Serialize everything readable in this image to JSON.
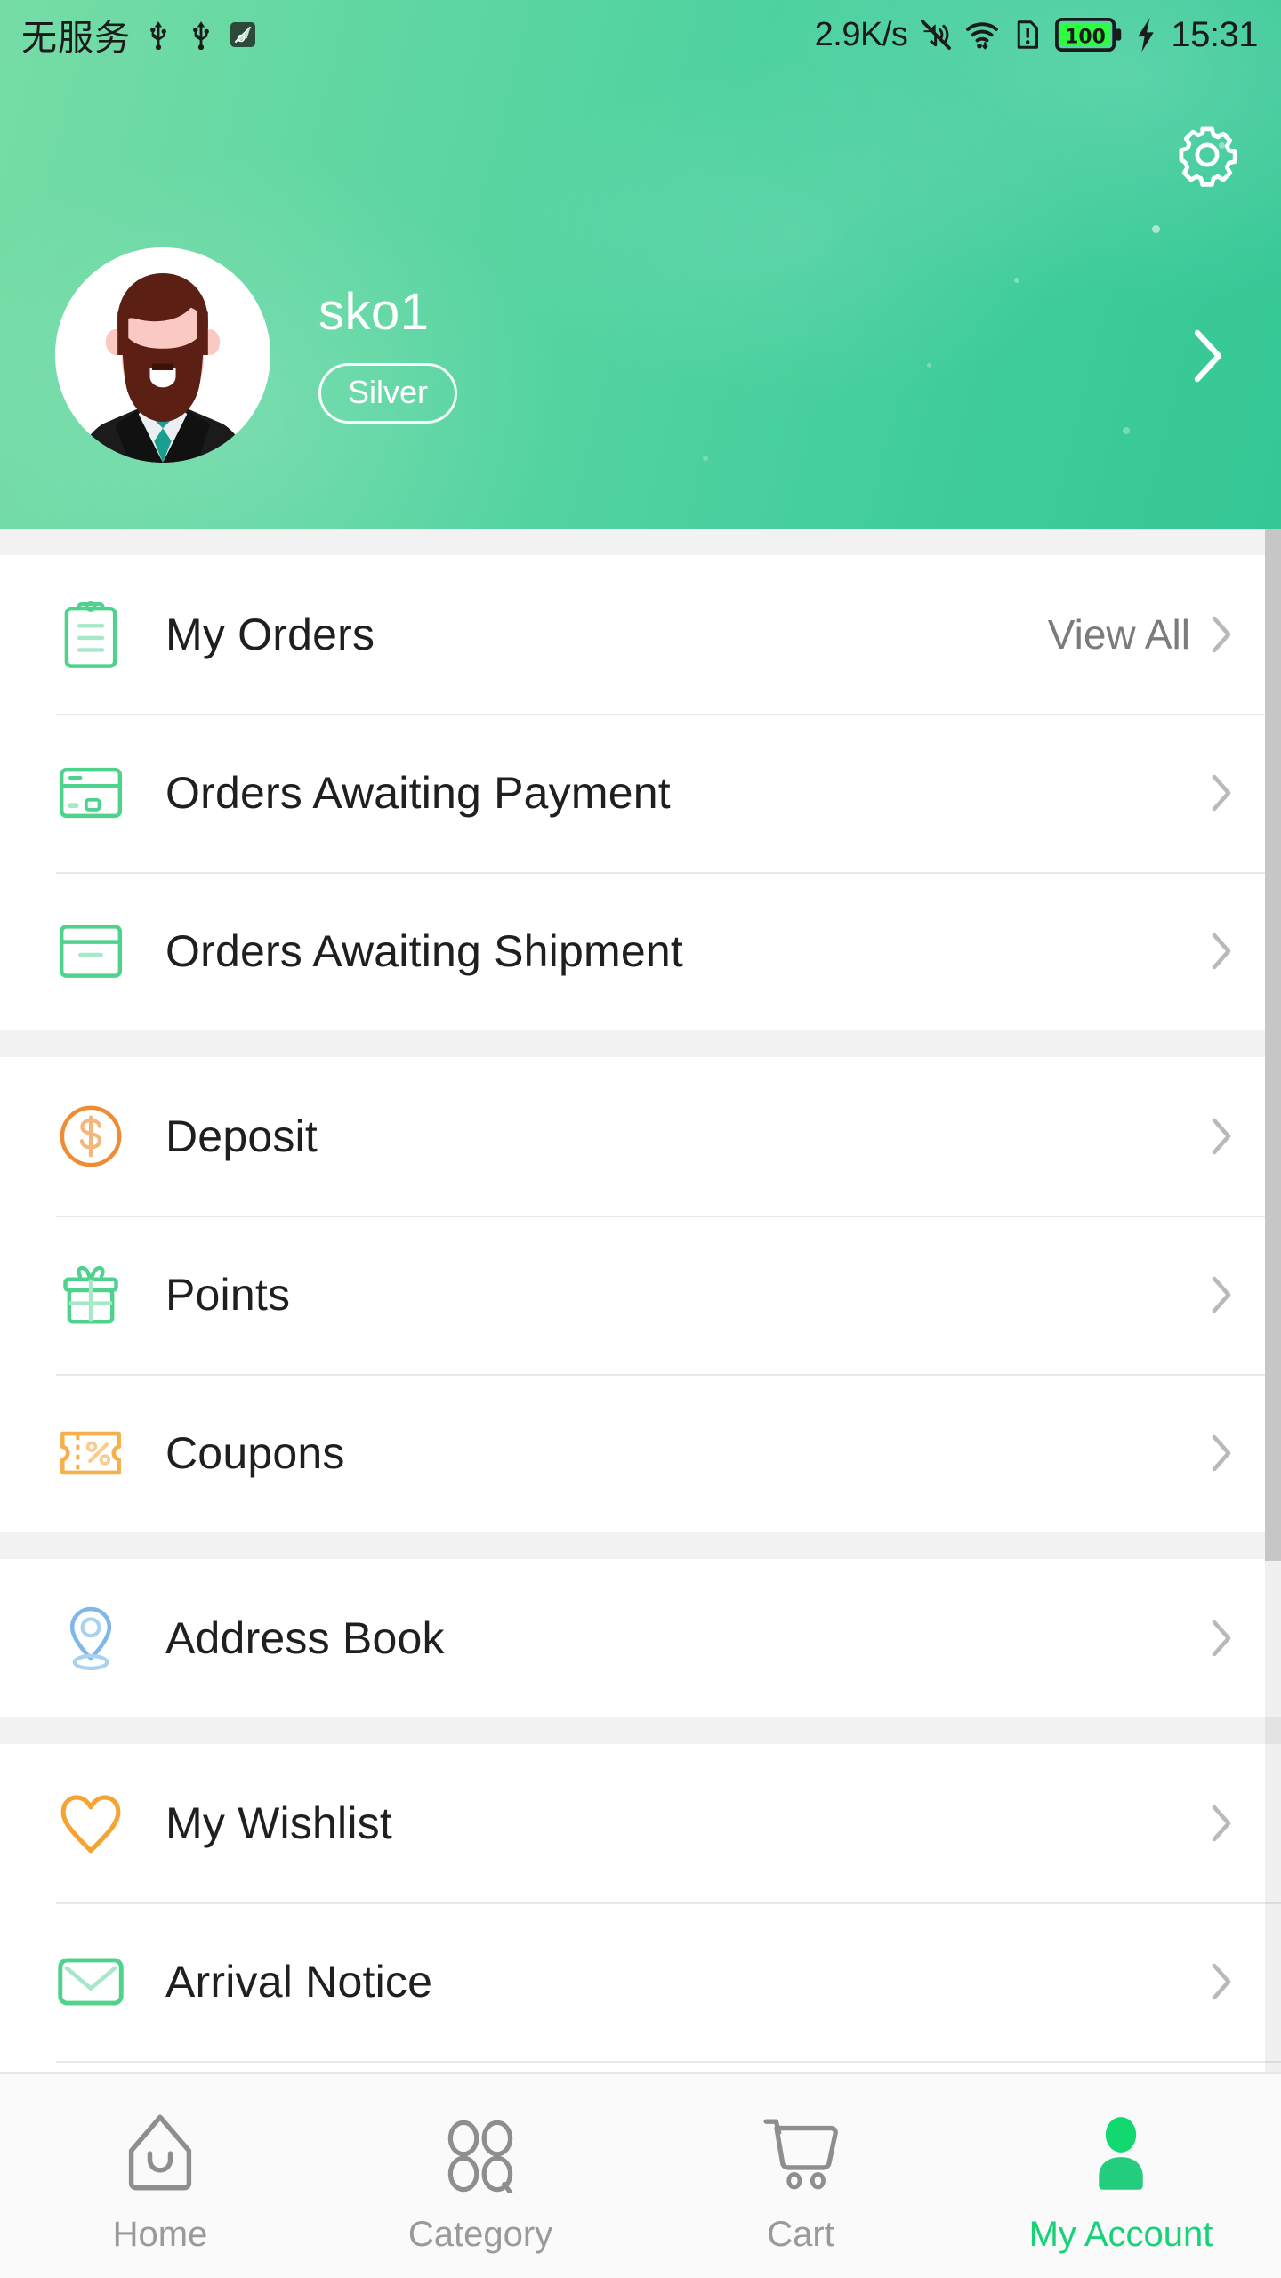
{
  "status_bar": {
    "carrier": "无服务",
    "icons_left": [
      "usb-icon",
      "usb-icon",
      "screenshot-icon"
    ],
    "network_speed": "2.9K/s",
    "icons_right": [
      "mute-icon",
      "wifi-icon",
      "sim-alert-icon"
    ],
    "battery_level": "100",
    "charging": "charging-bolt-icon",
    "time": "15:31"
  },
  "header": {
    "settings_icon": "gear-icon",
    "avatar_icon": "user-avatar",
    "username": "sko1",
    "member_level": "Silver",
    "chevron": "chevron-right-icon",
    "gradient_from": "#76DCA7",
    "gradient_to": "#35C795"
  },
  "groups": [
    {
      "rows": [
        {
          "label": "My Orders",
          "icon": "clipboard-icon",
          "icon_color": "#4FD28C",
          "action_label": "View All"
        },
        {
          "label": "Orders Awaiting Payment",
          "icon": "credit-card-icon",
          "icon_color": "#4FD28C",
          "action_label": ""
        },
        {
          "label": "Orders Awaiting Shipment",
          "icon": "package-box-icon",
          "icon_color": "#4FD28C",
          "action_label": ""
        }
      ]
    },
    {
      "rows": [
        {
          "label": "Deposit",
          "icon": "dollar-circle-icon",
          "icon_color": "#F08B32",
          "action_label": ""
        },
        {
          "label": "Points",
          "icon": "gift-box-icon",
          "icon_color": "#4FD28C",
          "action_label": ""
        },
        {
          "label": "Coupons",
          "icon": "coupon-ticket-icon",
          "icon_color": "#F5AF4B",
          "action_label": ""
        }
      ]
    },
    {
      "rows": [
        {
          "label": "Address Book",
          "icon": "location-pin-icon",
          "icon_color": "#7FB8E8",
          "action_label": ""
        }
      ]
    },
    {
      "rows": [
        {
          "label": "My Wishlist",
          "icon": "heart-icon",
          "icon_color": "#F5A431",
          "action_label": ""
        },
        {
          "label": "Arrival Notice",
          "icon": "envelope-icon",
          "icon_color": "#4FD28C",
          "action_label": ""
        }
      ]
    }
  ],
  "tabbar": {
    "active_color": "#18d278",
    "inactive_color": "#9a9a9a",
    "tabs": [
      {
        "label": "Home",
        "icon": "home-icon",
        "active": false
      },
      {
        "label": "Category",
        "icon": "grid-circles-icon",
        "active": false
      },
      {
        "label": "Cart",
        "icon": "shopping-cart-icon",
        "active": false
      },
      {
        "label": "My Account",
        "icon": "person-icon",
        "active": true
      }
    ]
  }
}
